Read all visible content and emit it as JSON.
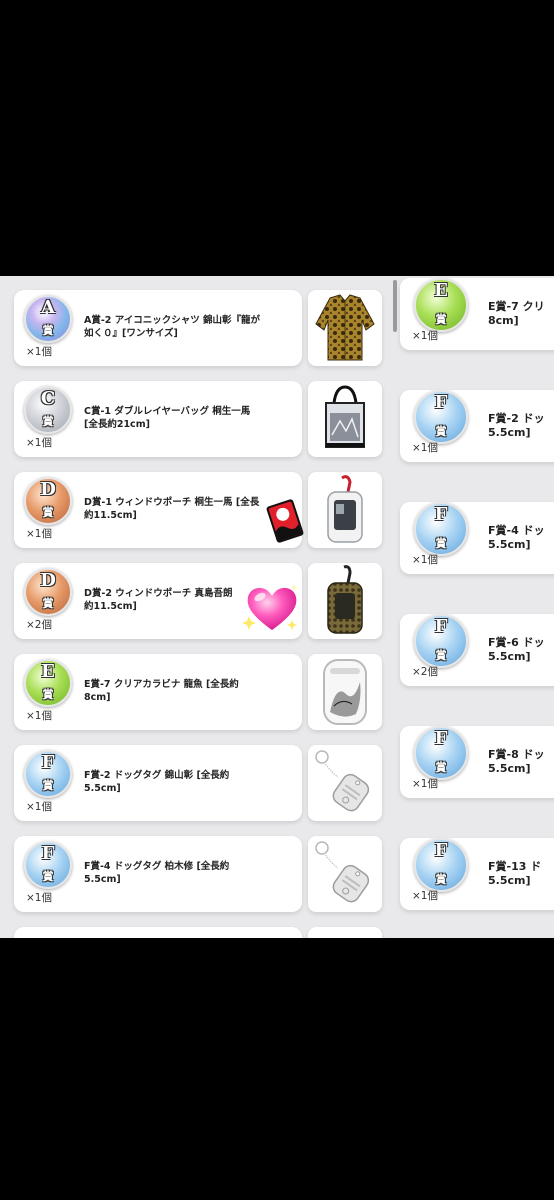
{
  "left_items": [
    {
      "grade": "A",
      "title": "A賞-2 アイコニックシャツ 錦山彰『龍が\n如く０』[ワンサイズ]",
      "qty": "×1個",
      "image": "leopard-shirt"
    },
    {
      "grade": "C",
      "title": "C賞-1 ダブルレイヤーバッグ 桐生一馬\n[全長約21cm]",
      "qty": "×1個",
      "image": "tote-bag"
    },
    {
      "grade": "D",
      "title": "D賞-1 ウィンドウポーチ 桐生一馬 [全長\n約11.5cm]",
      "qty": "×1個",
      "image": "window-pouch-white"
    },
    {
      "grade": "D",
      "title": "D賞-2 ウィンドウポーチ 真島吾朗\n約11.5cm]",
      "qty": "×2個",
      "image": "window-pouch-snake"
    },
    {
      "grade": "E",
      "title": "E賞-7 クリアカラビナ 龍魚 [全長約\n8cm]",
      "qty": "×1個",
      "image": "clear-carabiner"
    },
    {
      "grade": "F",
      "title": "F賞-2 ドッグタグ 錦山彰 [全長約\n5.5cm]",
      "qty": "×1個",
      "image": "dog-tag"
    },
    {
      "grade": "F",
      "title": "F賞-4 ドッグタグ 柏木修 [全長約\n5.5cm]",
      "qty": "×1個",
      "image": "dog-tag"
    }
  ],
  "right_items": [
    {
      "grade": "E",
      "title": "E賞-7 クリ\n8cm]",
      "qty": "×1個"
    },
    {
      "grade": "F",
      "title": "F賞-2 ドッ\n5.5cm]",
      "qty": "×1個"
    },
    {
      "grade": "F",
      "title": "F賞-4 ドッ\n5.5cm]",
      "qty": "×1個"
    },
    {
      "grade": "F",
      "title": "F賞-6 ドッ\n5.5cm]",
      "qty": "×2個"
    },
    {
      "grade": "F",
      "title": "F賞-8 ドッ\n5.5cm]",
      "qty": "×1個"
    },
    {
      "grade": "F",
      "title": "F賞-13 ド\n5.5cm]",
      "qty": "×1個"
    }
  ],
  "badge_suffix": "賞",
  "colors": {
    "background": "#000000",
    "panel": "#e9e9ec",
    "card": "#ffffff",
    "heart": "#ff3fa8"
  }
}
